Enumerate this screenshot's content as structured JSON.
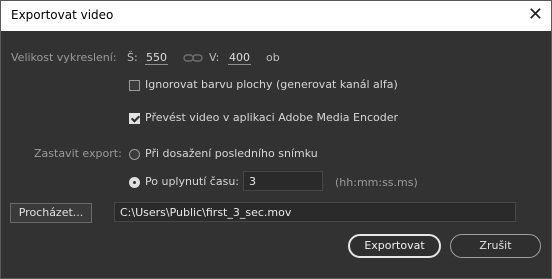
{
  "window": {
    "title": "Exportovat video",
    "close_glyph": "✕"
  },
  "size": {
    "label": "Velikost vykreslení:",
    "width_label": "Š:",
    "width_value": "550",
    "link_icon": "chain-link-icon",
    "height_label": "V:",
    "height_value": "400",
    "unit": "ob"
  },
  "options": {
    "ignore_bg_label": "Ignorovat barvu plochy (generovat kanál alfa)",
    "ignore_bg_checked": false,
    "convert_label": "Převést video v aplikaci Adobe Media Encoder",
    "convert_checked": true
  },
  "stop": {
    "label": "Zastavit export:",
    "last_frame_label": "Při dosažení posledního snímku",
    "after_time_label": "Po uplynutí času:",
    "selected": "after_time",
    "time_value": "3",
    "time_format": "(hh:mm:ss.ms)"
  },
  "output": {
    "browse_label": "Procházet...",
    "path": "C:\\Users\\Public\\first_3_sec.mov"
  },
  "buttons": {
    "export": "Exportovat",
    "cancel": "Zrušit"
  }
}
